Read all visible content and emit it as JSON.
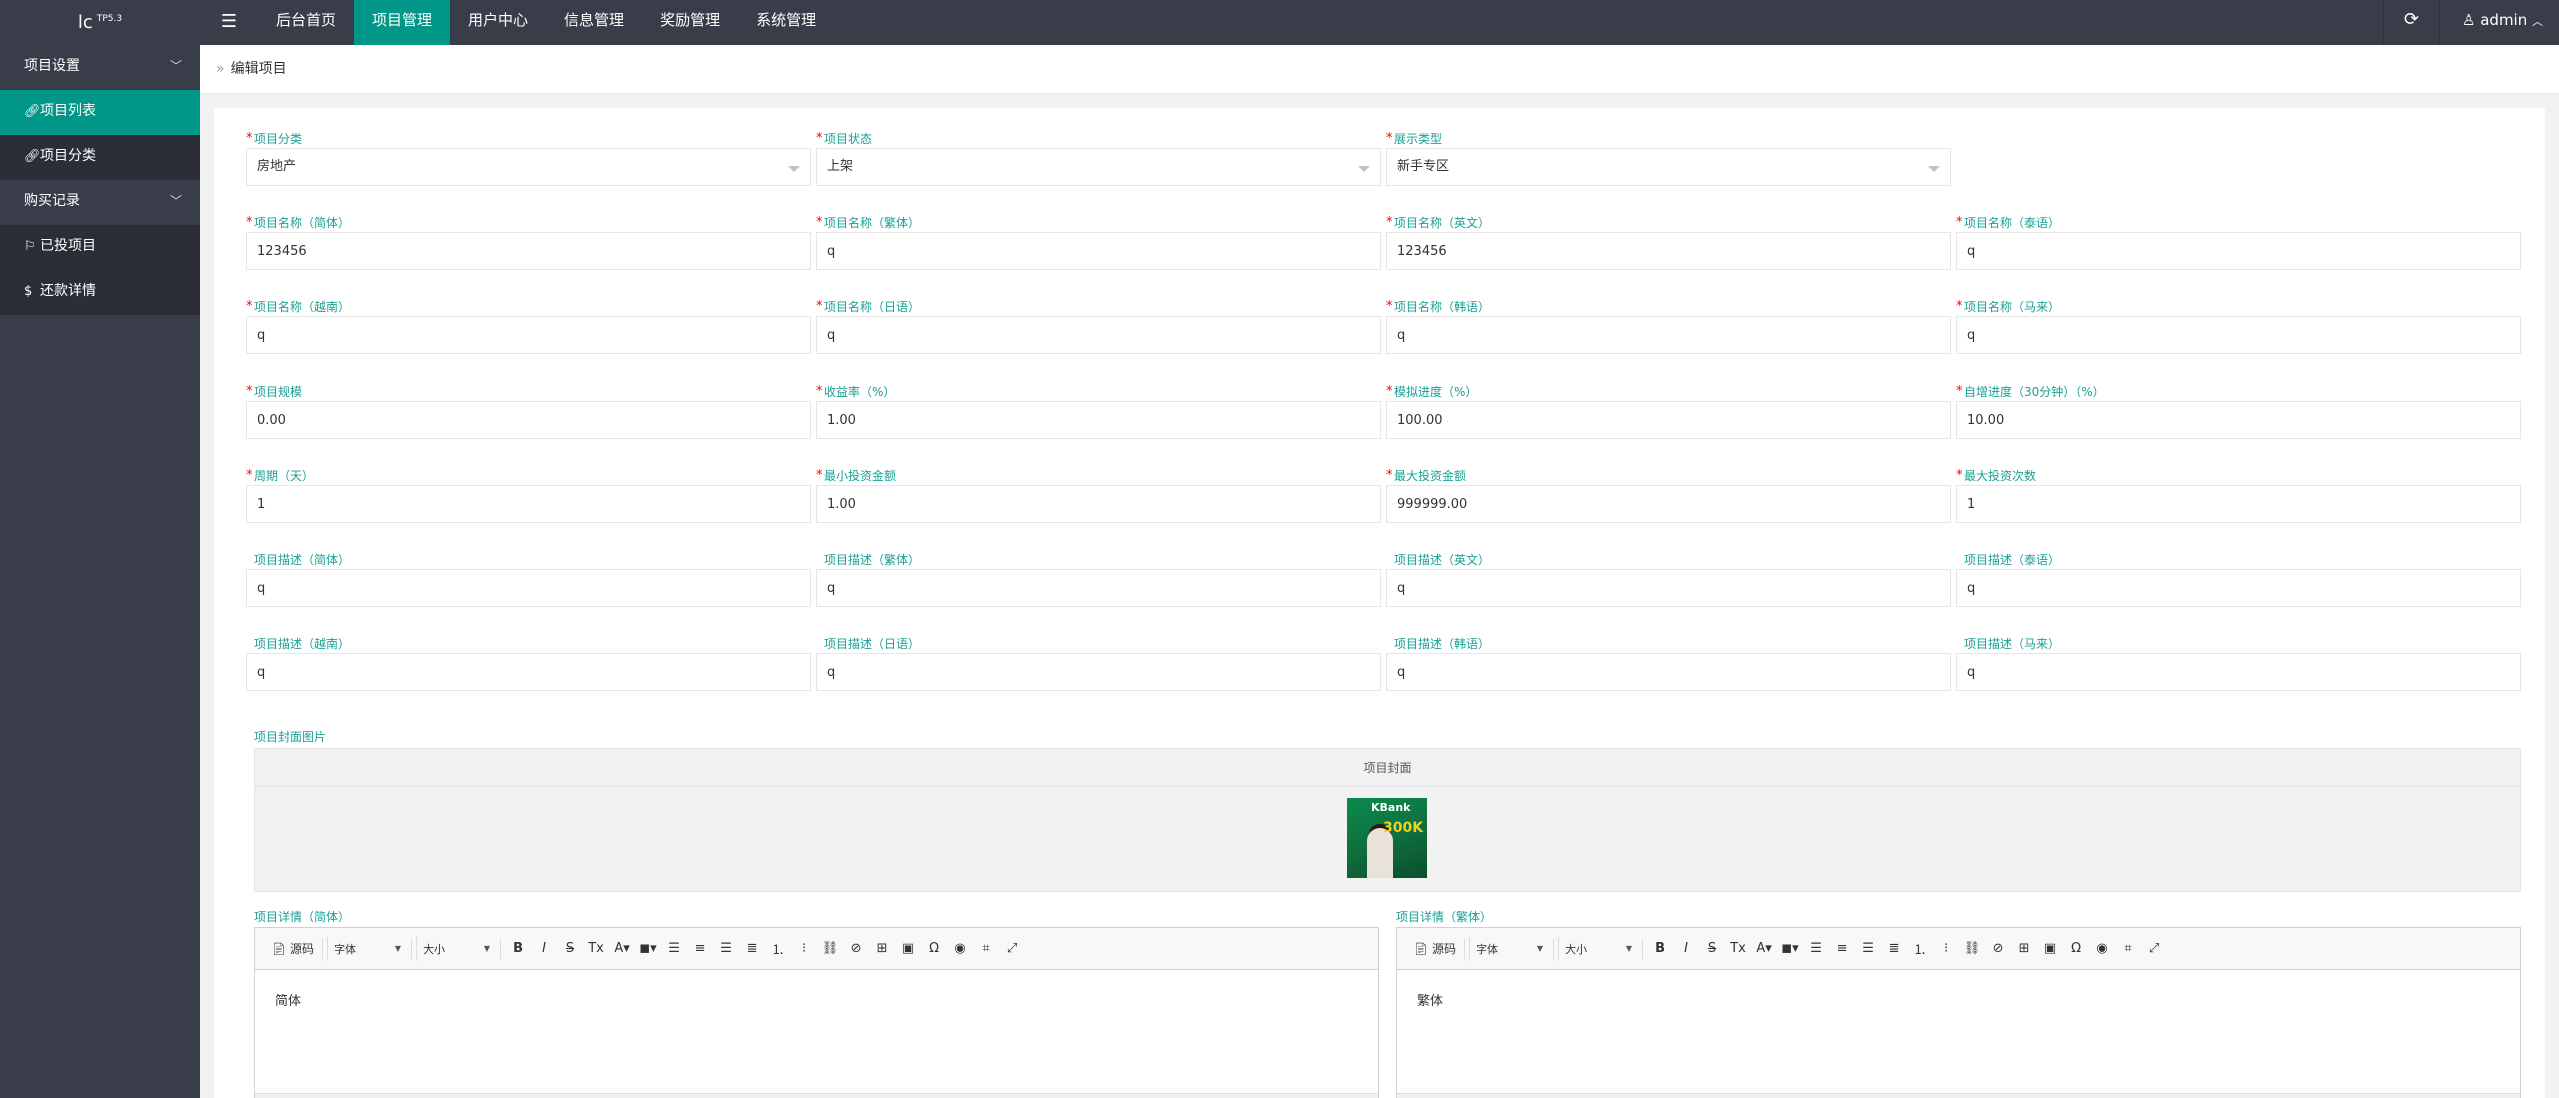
{
  "header": {
    "logo": "lc",
    "logo_sup": "TP5.3",
    "menu_icon": "menu-icon",
    "nav": [
      {
        "label": "后台首页",
        "active": false
      },
      {
        "label": "项目管理",
        "active": true
      },
      {
        "label": "用户中心",
        "active": false
      },
      {
        "label": "信息管理",
        "active": false
      },
      {
        "label": "奖励管理",
        "active": false
      },
      {
        "label": "系统管理",
        "active": false
      }
    ],
    "user": "admin",
    "accent": "#009688"
  },
  "sidebar": {
    "groups": [
      {
        "label": "项目设置",
        "items": [
          {
            "label": "项目列表",
            "icon": "link-icon",
            "active": true
          },
          {
            "label": "项目分类",
            "icon": "link-icon",
            "active": false
          }
        ]
      },
      {
        "label": "购买记录",
        "items": [
          {
            "label": "已投项目",
            "icon": "flag-icon",
            "active": false
          },
          {
            "label": "还款详情",
            "icon": "dollar-icon",
            "active": false
          }
        ]
      }
    ]
  },
  "breadcrumb": "编辑项目",
  "form": {
    "selects": [
      {
        "label": "项目分类",
        "value": "房地产",
        "required": true
      },
      {
        "label": "项目状态",
        "value": "上架",
        "required": true
      },
      {
        "label": "展示类型",
        "value": "新手专区",
        "required": true
      }
    ],
    "rows": [
      [
        {
          "label": "项目名称（简体）",
          "value": "123456",
          "required": true
        },
        {
          "label": "项目名称（繁体）",
          "value": "q",
          "required": true
        },
        {
          "label": "项目名称（英文）",
          "value": "123456",
          "required": true
        },
        {
          "label": "项目名称（泰语）",
          "value": "q",
          "required": true
        }
      ],
      [
        {
          "label": "项目名称（越南）",
          "value": "q",
          "required": true
        },
        {
          "label": "项目名称（日语）",
          "value": "q",
          "required": true
        },
        {
          "label": "项目名称（韩语）",
          "value": "q",
          "required": true
        },
        {
          "label": "项目名称（马来）",
          "value": "q",
          "required": true
        }
      ],
      [
        {
          "label": "项目规模",
          "value": "0.00",
          "required": true
        },
        {
          "label": "收益率（%）",
          "value": "1.00",
          "required": true
        },
        {
          "label": "模拟进度（%）",
          "value": "100.00",
          "required": true
        },
        {
          "label": "自增进度（30分钟）（%）",
          "value": "10.00",
          "required": true
        }
      ],
      [
        {
          "label": "周期（天）",
          "value": "1",
          "required": true
        },
        {
          "label": "最小投资金额",
          "value": "1.00",
          "required": true
        },
        {
          "label": "最大投资金额",
          "value": "999999.00",
          "required": true
        },
        {
          "label": "最大投资次数",
          "value": "1",
          "required": true
        }
      ],
      [
        {
          "label": "项目描述（简体）",
          "value": "q",
          "required": false
        },
        {
          "label": "项目描述（繁体）",
          "value": "q",
          "required": false
        },
        {
          "label": "项目描述（英文）",
          "value": "q",
          "required": false
        },
        {
          "label": "项目描述（泰语）",
          "value": "q",
          "required": false
        }
      ],
      [
        {
          "label": "项目描述（越南）",
          "value": "q",
          "required": false
        },
        {
          "label": "项目描述（日语）",
          "value": "q",
          "required": false
        },
        {
          "label": "项目描述（韩语）",
          "value": "q",
          "required": false
        },
        {
          "label": "项目描述（马来）",
          "value": "q",
          "required": false
        }
      ]
    ],
    "cover": {
      "label": "项目封面图片",
      "title": "项目封面",
      "image_brand": "KBank",
      "image_text": "300K"
    },
    "editors": [
      {
        "label": "项目详情（简体）",
        "content": "简体"
      },
      {
        "label": "项目详情（繁体）",
        "content": "繁体"
      }
    ],
    "toolbar": {
      "source": "源码",
      "font": "字体",
      "size": "大小"
    }
  }
}
